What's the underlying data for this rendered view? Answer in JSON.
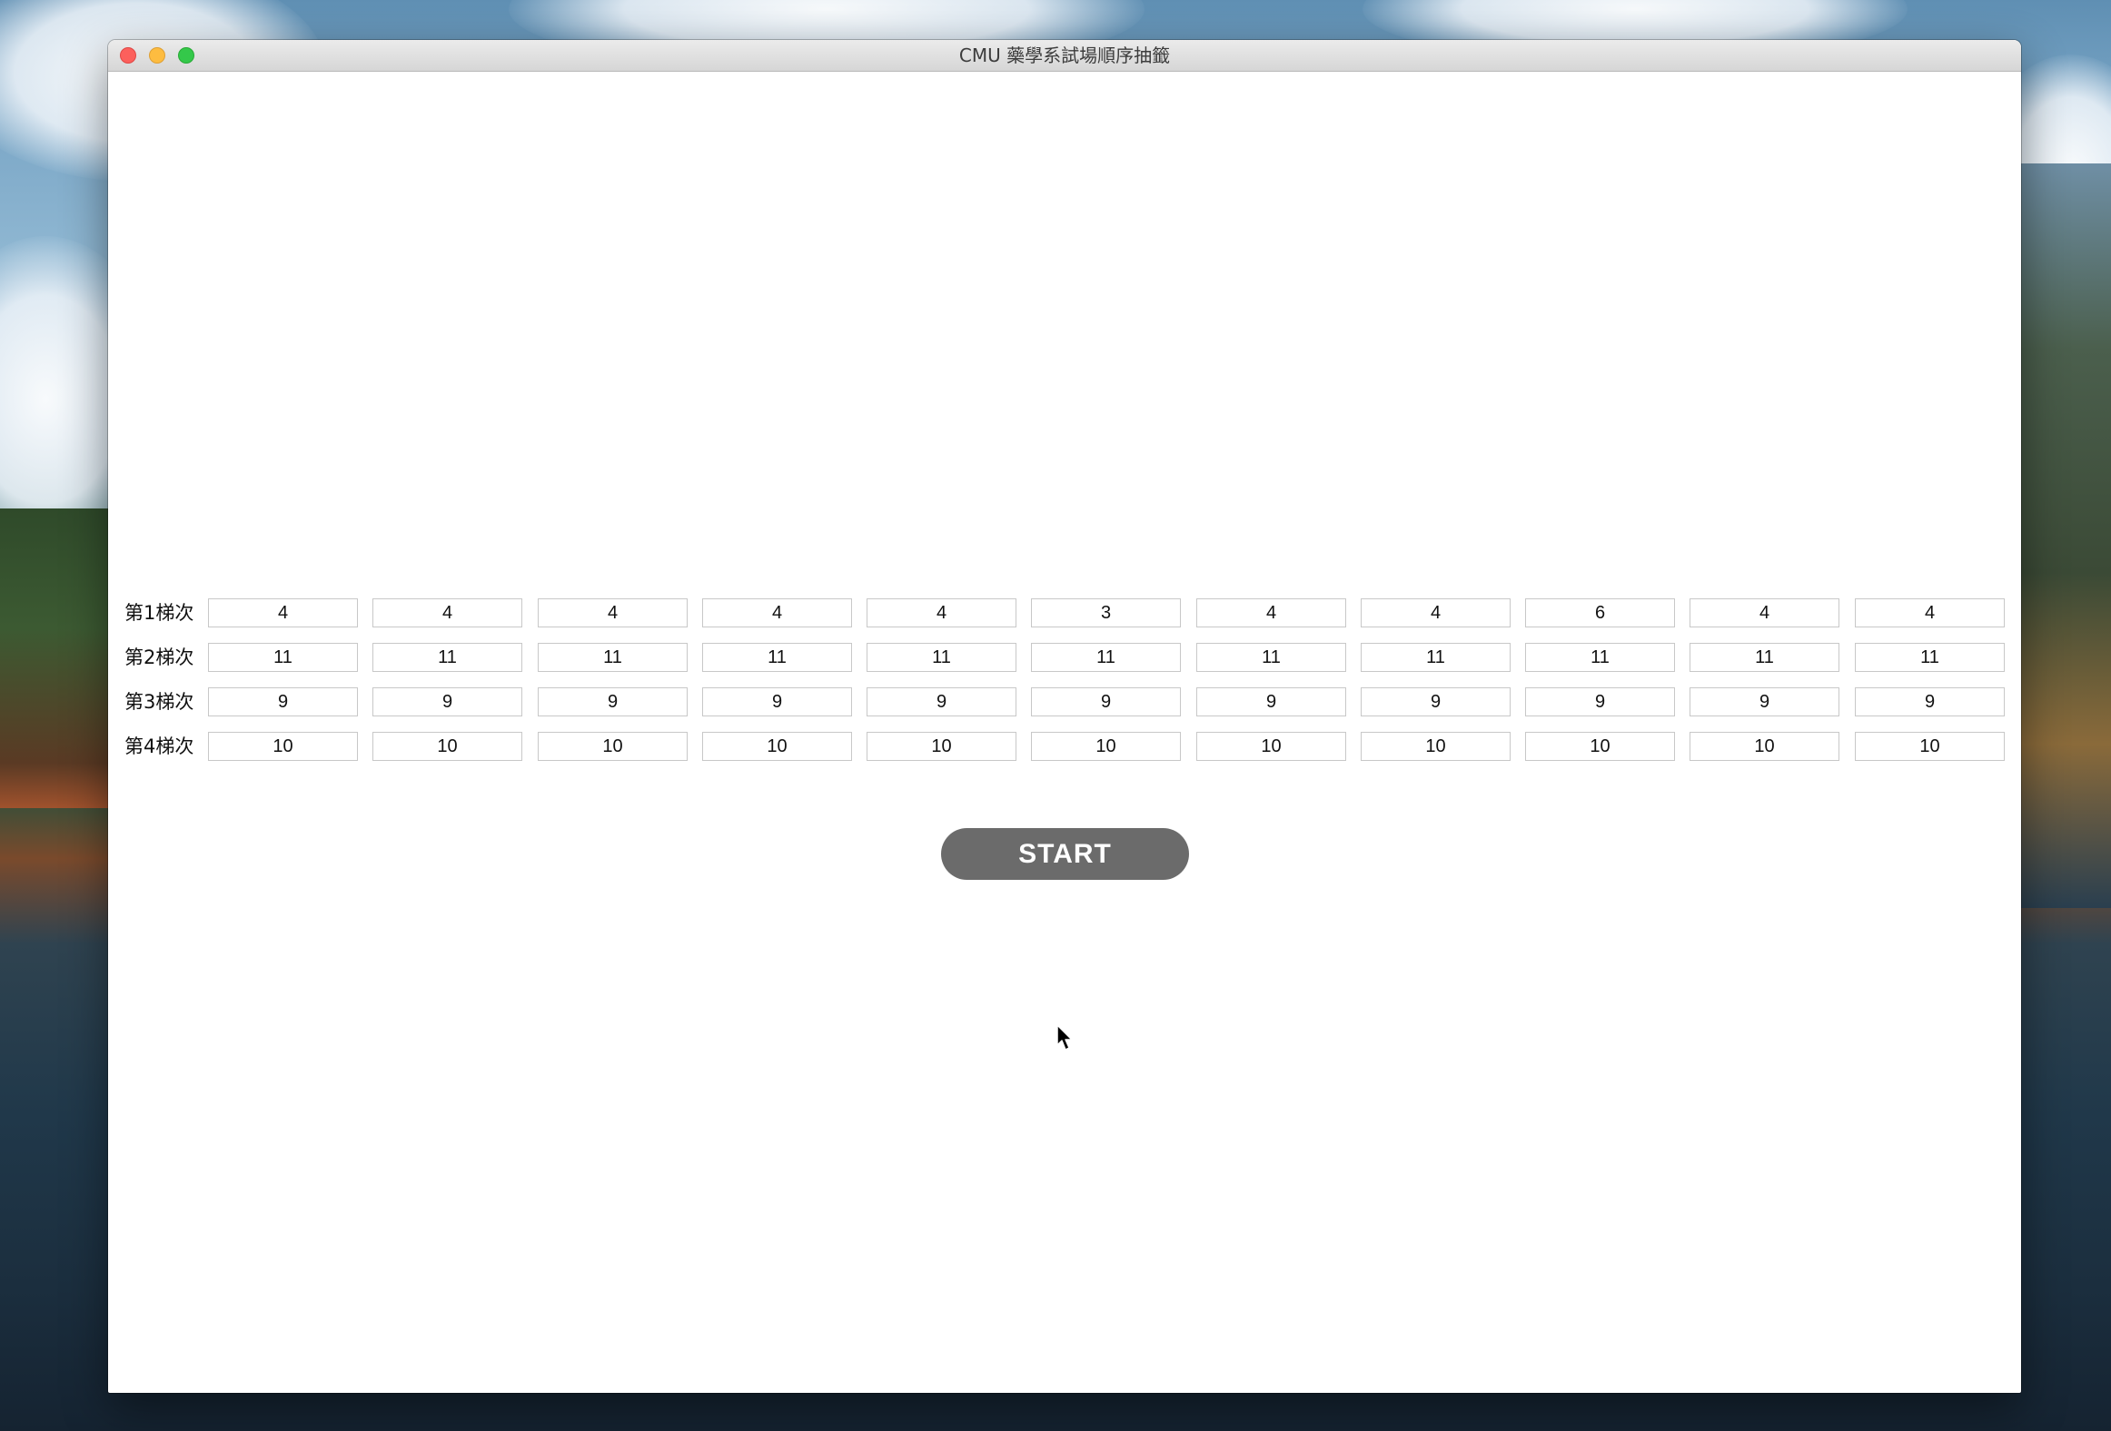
{
  "window": {
    "title": "CMU 藥學系試場順序抽籤"
  },
  "rows": [
    {
      "label": "第1梯次",
      "values": [
        "4",
        "4",
        "4",
        "4",
        "4",
        "3",
        "4",
        "4",
        "6",
        "4",
        "4"
      ]
    },
    {
      "label": "第2梯次",
      "values": [
        "11",
        "11",
        "11",
        "11",
        "11",
        "11",
        "11",
        "11",
        "11",
        "11",
        "11"
      ]
    },
    {
      "label": "第3梯次",
      "values": [
        "9",
        "9",
        "9",
        "9",
        "9",
        "9",
        "9",
        "9",
        "9",
        "9",
        "9"
      ]
    },
    {
      "label": "第4梯次",
      "values": [
        "10",
        "10",
        "10",
        "10",
        "10",
        "10",
        "10",
        "10",
        "10",
        "10",
        "10"
      ]
    }
  ],
  "start_button": {
    "label": "START",
    "color": "#6b6b6b"
  },
  "colors": {
    "close": "#fc605c",
    "minimize": "#fdbc40",
    "maximize": "#34c84a"
  }
}
